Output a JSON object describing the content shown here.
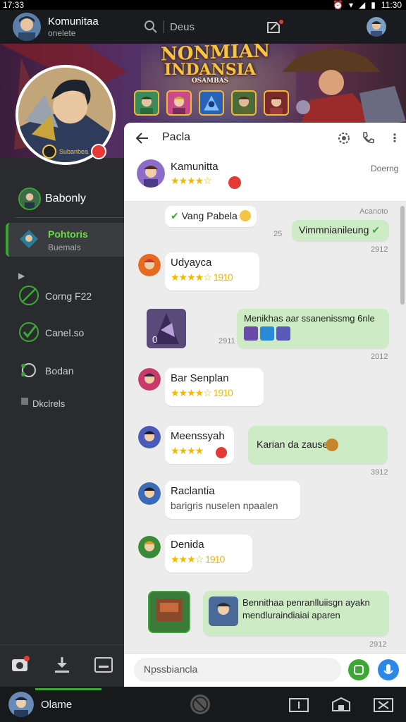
{
  "status_bar": {
    "time_left": "17:33",
    "time_right": "11:30"
  },
  "top_bar": {
    "title": "Komunitaa",
    "subtitle": "onelete",
    "search_label": "Deus"
  },
  "banner": {
    "title_line1": "NONMIAN",
    "title_line2": "INDANSIA",
    "title_line3": "OSAMBAS",
    "badge_text": "Subanbea"
  },
  "sidebar": {
    "user_name": "Babonly",
    "items": [
      {
        "label": "Pohtoris",
        "sublabel": "Buemals"
      },
      {
        "label": "Corng F22"
      },
      {
        "label": "Canel.so"
      },
      {
        "label": "Bodan"
      },
      {
        "label": "Dkclrels"
      }
    ]
  },
  "chat": {
    "header_title": "Pacla",
    "group_name": "Kamunitta",
    "group_status": "Doerng",
    "rating_stars": "★★★★☆",
    "messages": [
      {
        "sender": "",
        "text": "Vang Pabela",
        "time": "Acanoto",
        "side": "left"
      },
      {
        "sender": "",
        "text": "Vimmnianileung",
        "time": "2912",
        "extra": "25",
        "side": "right"
      },
      {
        "sender": "Udyayca",
        "text": "★★★★☆ 1910",
        "time": "",
        "side": "left"
      },
      {
        "sender": "",
        "text": "Menikhas aar ssanenissmg 6nle",
        "time": "2012",
        "extra": "2911",
        "side": "right"
      },
      {
        "sender": "Bar Senplan",
        "text": "★★★★☆ 1910",
        "side": "left"
      },
      {
        "sender": "Meenssyah",
        "text": "★★★★",
        "side": "left"
      },
      {
        "sender": "",
        "text": "Karian da zausen",
        "time": "3912",
        "side": "right"
      },
      {
        "sender": "Raclantia",
        "text": "barigris nuselen npaalen",
        "side": "left"
      },
      {
        "sender": "Denida",
        "text": "★★★☆ 1910",
        "side": "left"
      },
      {
        "sender": "",
        "text": "Bennithaa penranlluiisgn ayakn mendluraindiaiai aparen",
        "time": "2912",
        "side": "right"
      }
    ],
    "tile_count": "0",
    "composer_placeholder": "Npssbiancla"
  },
  "bottom_nav": {
    "user_name": "Olame"
  },
  "colors": {
    "accent_green": "#3aa832",
    "accent_blue": "#2b87e8",
    "bubble_green": "#cdebc4",
    "star": "#f3b800"
  }
}
